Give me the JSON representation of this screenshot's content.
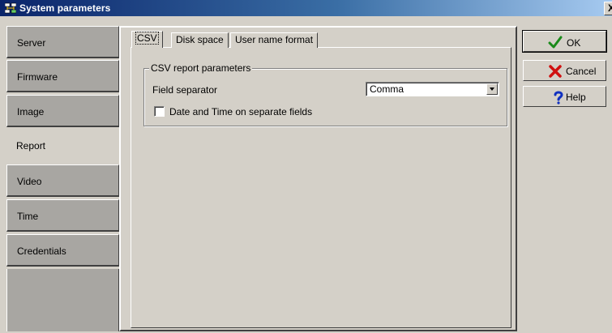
{
  "window": {
    "title": "System parameters",
    "close_label": "X"
  },
  "nav": {
    "items": [
      {
        "label": "Server"
      },
      {
        "label": "Firmware"
      },
      {
        "label": "Image"
      },
      {
        "label": "Report",
        "selected": true
      },
      {
        "label": "Video"
      },
      {
        "label": "Time"
      },
      {
        "label": "Credentials"
      }
    ]
  },
  "tabs": [
    {
      "label": "CSV",
      "active": true
    },
    {
      "label": "Disk space"
    },
    {
      "label": "User name format"
    }
  ],
  "csv": {
    "group_title": "CSV report parameters",
    "field_separator_label": "Field separator",
    "field_separator_value": "Comma",
    "date_time_label": "Date and Time on separate fields",
    "date_time_checked": false
  },
  "buttons": {
    "ok": "OK",
    "cancel": "Cancel",
    "help": "Help"
  },
  "icons": {
    "app": "network-computers-icon",
    "ok": "checkmark-icon",
    "cancel": "red-x-icon",
    "help": "question-mark-icon"
  },
  "colors": {
    "title_gradient_start": "#0a246a",
    "title_gradient_end": "#a6caf0",
    "window_bg": "#d4d0c8",
    "nav_item_bg": "#a8a6a2",
    "ok_green": "#1a8a1a",
    "cancel_red": "#d01010",
    "help_blue": "#1030c0"
  }
}
